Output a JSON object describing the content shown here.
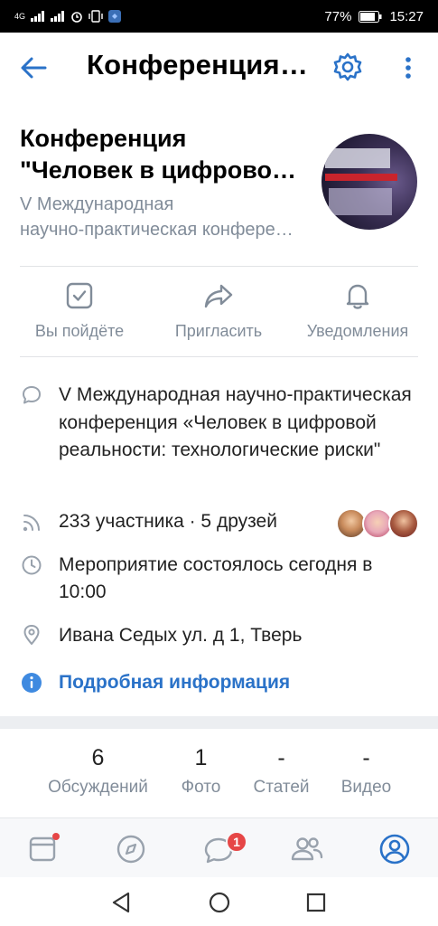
{
  "status_bar": {
    "network": "4G",
    "battery": "77%",
    "time": "15:27"
  },
  "toolbar": {
    "title": "Конференция \"Человек в цифровой реальности\""
  },
  "header": {
    "name_line1": "Конференция",
    "name_line2": "\"Человек в цифровой реальности\"",
    "subtitle_line1": "V Международная",
    "subtitle_line2": "научно-практическая конференция"
  },
  "actions": [
    {
      "label": "Вы пойдёте",
      "icon": "check-square-icon"
    },
    {
      "label": "Пригласить",
      "icon": "share-arrow-icon"
    },
    {
      "label": "Уведомления",
      "icon": "bell-icon"
    }
  ],
  "info": {
    "description": "V Международная научно-практическая конференция «Человек в цифровой реальности: технологические риски\"",
    "members": "233 участника · 5 друзей",
    "time": "Мероприятие состоялось сегодня в 10:00",
    "address": "Ивана Седых ул. д 1, Тверь",
    "more_link": "Подробная информация"
  },
  "counters": [
    {
      "value": "6",
      "label": "Обсуждений"
    },
    {
      "value": "1",
      "label": "Фото"
    },
    {
      "value": "-",
      "label": "Статей"
    },
    {
      "value": "-",
      "label": "Видео"
    }
  ],
  "tabbar": {
    "messages_badge": "1"
  },
  "colors": {
    "accent": "#2a72c8",
    "secondary_text": "#818c99",
    "badge_red": "#e64646"
  }
}
